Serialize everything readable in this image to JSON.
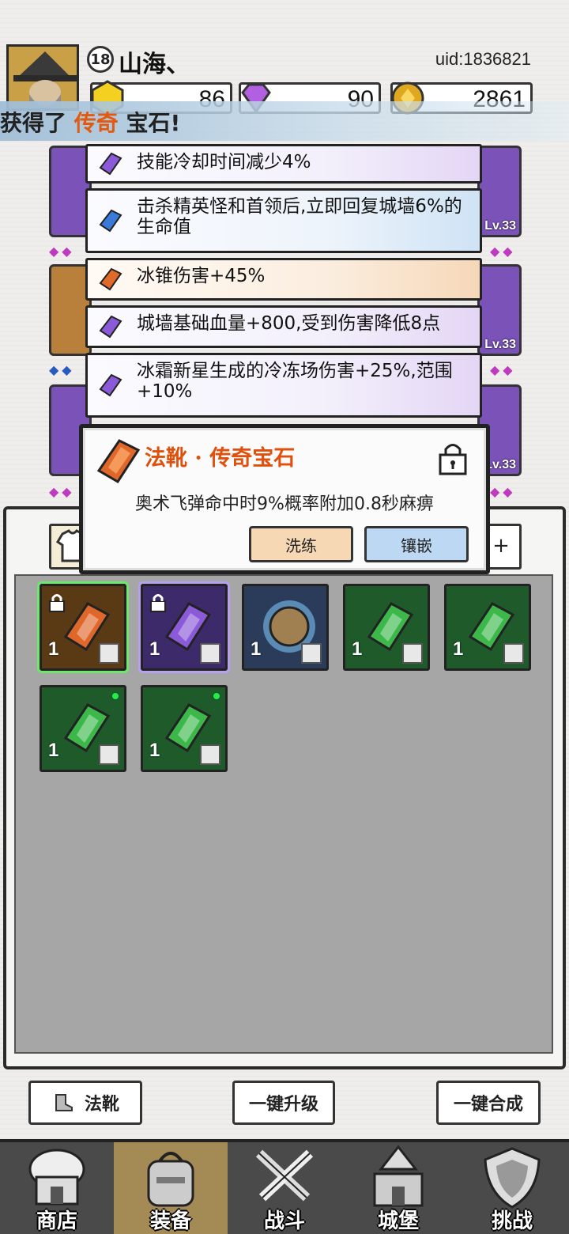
{
  "header": {
    "level": "18",
    "player_name": "山海、",
    "uid": "uid:1836821",
    "resources": [
      {
        "name": "gold-hex",
        "value": "86",
        "color": "#f4d020"
      },
      {
        "name": "purple-diamond",
        "value": "90",
        "color": "#b060e0"
      },
      {
        "name": "coin",
        "value": "2861",
        "color": "#e0a820"
      }
    ]
  },
  "banner": {
    "prefix": "获得了 ",
    "highlight": "传奇",
    "suffix": " 宝石!"
  },
  "affixes": [
    {
      "text": "技能冷却时间减少4%",
      "gem": "purple"
    },
    {
      "text": "击杀精英怪和首领后,立即回复城墙6%的生命值",
      "gem": "blue"
    },
    {
      "text": "冰锥伤害+45%",
      "gem": "orange"
    },
    {
      "text": "城墙基础血量+800,受到伤害降低8点",
      "gem": "purple"
    },
    {
      "text": "冰霜新星生成的冷冻场伤害+25%,范围+10%",
      "gem": "purple"
    }
  ],
  "equipment_levels": [
    "Lv.33",
    "Lv.33",
    "Lv.33"
  ],
  "popup": {
    "title": "法靴 · 传奇宝石",
    "description": "奥术飞弹命中时9%概率附加0.8秒麻痹",
    "reforge_label": "洗练",
    "inlay_label": "镶嵌"
  },
  "inventory_tab_right": "+",
  "inventory": [
    {
      "type": "orange",
      "count": "1",
      "locked": true,
      "dot": false
    },
    {
      "type": "purple",
      "count": "1",
      "locked": true,
      "dot": false
    },
    {
      "type": "blue",
      "count": "1",
      "locked": false,
      "dot": false
    },
    {
      "type": "green",
      "count": "1",
      "locked": false,
      "dot": false
    },
    {
      "type": "green",
      "count": "1",
      "locked": false,
      "dot": false
    },
    {
      "type": "green",
      "count": "1",
      "locked": false,
      "dot": true
    },
    {
      "type": "green",
      "count": "1",
      "locked": false,
      "dot": true
    }
  ],
  "bottom_buttons": {
    "boots": "法靴",
    "upgrade_all": "一键升级",
    "merge_all": "一键合成"
  },
  "nav": [
    {
      "label": "商店",
      "icon": "shop-icon"
    },
    {
      "label": "装备",
      "icon": "backpack-icon"
    },
    {
      "label": "战斗",
      "icon": "crossed-swords-icon"
    },
    {
      "label": "城堡",
      "icon": "castle-icon"
    },
    {
      "label": "挑战",
      "icon": "shield-icon"
    }
  ],
  "colors": {
    "legendary": "#e0500c",
    "purple": "#7a52b8",
    "green": "#2a7a3a",
    "blue": "#4a7ab8"
  }
}
